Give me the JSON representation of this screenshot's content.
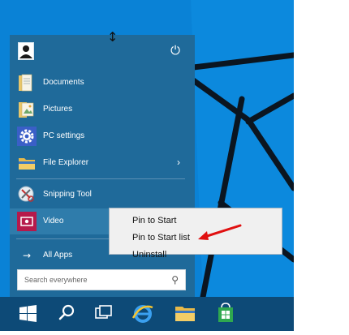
{
  "start_menu": {
    "power_glyph": "⏻",
    "resize_glyph": "↕",
    "items": [
      {
        "label": "Documents",
        "icon": "documents-folder-icon"
      },
      {
        "label": "Pictures",
        "icon": "pictures-folder-icon"
      },
      {
        "label": "PC settings",
        "icon": "gear-icon"
      },
      {
        "label": "File Explorer",
        "icon": "file-explorer-icon",
        "chevron": "›"
      },
      {
        "label": "Snipping Tool",
        "icon": "snipping-tool-icon"
      },
      {
        "label": "Video",
        "icon": "video-icon"
      }
    ],
    "all_apps": {
      "arrow": "→",
      "label": "All Apps"
    },
    "search": {
      "placeholder": "Search everywhere",
      "icon": "magnify-icon"
    }
  },
  "context_menu": {
    "items": [
      "Pin to Start",
      "Pin to Start list",
      "Uninstall"
    ]
  },
  "colors": {
    "desktop": "#0a82d6",
    "start_menu": "#1f6a9a",
    "taskbar": "#0d4a77",
    "annotation_arrow": "#e01010"
  },
  "taskbar": {
    "items": [
      "start-button",
      "search-button",
      "task-view-button",
      "internet-explorer-button",
      "file-explorer-button",
      "store-button"
    ]
  }
}
